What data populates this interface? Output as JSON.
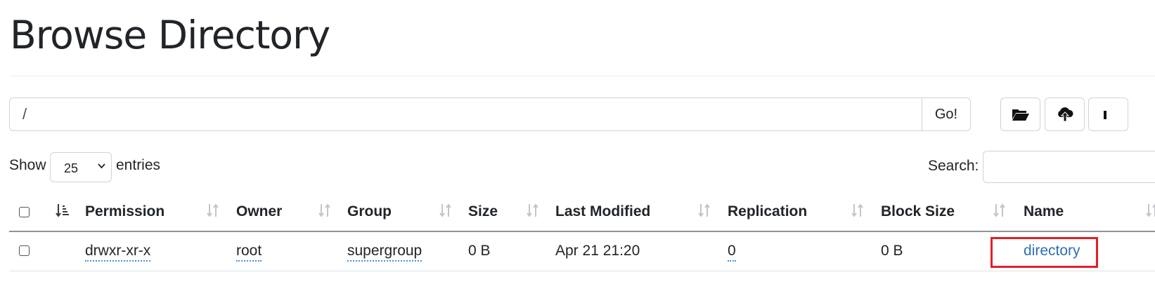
{
  "page": {
    "title": "Browse Directory"
  },
  "path_bar": {
    "value": "/",
    "go_label": "Go!"
  },
  "toolbar": {
    "buttons": [
      {
        "icon": "folder-open-icon"
      },
      {
        "icon": "cloud-upload-icon"
      },
      {
        "icon": "partial-button-icon"
      }
    ]
  },
  "length_control": {
    "show_label": "Show",
    "selected": "25",
    "entries_label": "entries"
  },
  "search": {
    "label": "Search:",
    "value": ""
  },
  "table": {
    "columns": [
      "Permission",
      "Owner",
      "Group",
      "Size",
      "Last Modified",
      "Replication",
      "Block Size",
      "Name"
    ],
    "rows": [
      {
        "permission": "drwxr-xr-x",
        "owner": "root",
        "group": "supergroup",
        "size": "0 B",
        "last_modified": "Apr 21 21:20",
        "replication": "0",
        "block_size": "0 B",
        "name": "directory"
      }
    ]
  },
  "colors": {
    "link": "#2f6fb1",
    "highlight_border": "#e0202a",
    "border": "#ced4da"
  }
}
